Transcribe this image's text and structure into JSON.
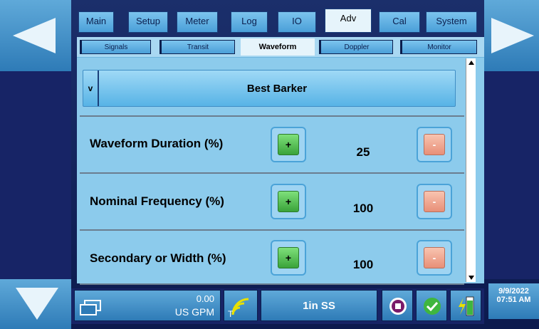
{
  "tabs": [
    {
      "label": "Main"
    },
    {
      "label": "Setup"
    },
    {
      "label": "Meter"
    },
    {
      "label": "Log"
    },
    {
      "label": "IO"
    },
    {
      "label": "Adv"
    },
    {
      "label": "Cal"
    },
    {
      "label": "System"
    }
  ],
  "active_tab": "Adv",
  "subtabs": [
    {
      "label": "Signals"
    },
    {
      "label": "Transit"
    },
    {
      "label": "Waveform"
    },
    {
      "label": "Doppler"
    },
    {
      "label": "Monitor"
    }
  ],
  "active_subtab": "Waveform",
  "dropdown": {
    "indicator": "v",
    "selected": "Best Barker"
  },
  "rows": [
    {
      "label": "Waveform Duration (%)",
      "plus": "+",
      "value": "25",
      "minus": "-"
    },
    {
      "label": "Nominal Frequency (%)",
      "plus": "+",
      "value": "100",
      "minus": "-"
    },
    {
      "label": "Secondary or Width (%)",
      "plus": "+",
      "value": "100",
      "minus": "-"
    }
  ],
  "status": {
    "flow_value": "0.00",
    "flow_unit": "US GPM",
    "signal_letter": "T",
    "pipe": "1in SS",
    "date": "9/9/2022",
    "time": "07:51 AM"
  },
  "colors": {
    "accent": "#4a9fd8",
    "panel": "#8ccbec",
    "plus": "#3aa33a",
    "minus": "#e88f78",
    "frame": "#172466"
  }
}
